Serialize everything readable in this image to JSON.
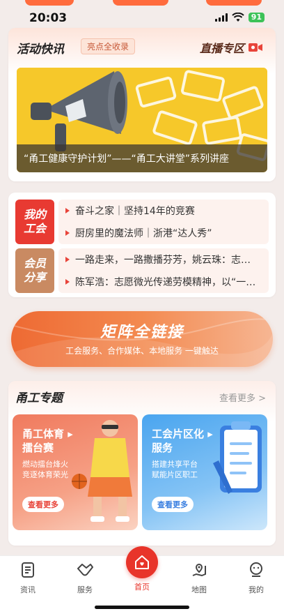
{
  "status_bar": {
    "time": "20:03",
    "battery": "91"
  },
  "activity": {
    "title": "活动快讯",
    "badge": "亮点全收录",
    "live_label": "直播专区",
    "banner_caption": "“甬工健康守护计划”——“甬工大讲堂”系列讲座"
  },
  "union_news": {
    "groups": [
      {
        "tag_line1": "我的",
        "tag_line2": "工会",
        "tag_color": "#e83a32",
        "items": [
          "奋斗之家｜坚持14年的竞赛",
          "厨房里的魔法师｜浙港“达人秀”"
        ]
      },
      {
        "tag_line1": "会员",
        "tag_line2": "分享",
        "tag_color": "#c98a62",
        "items": [
          "一路走来，一路撒播芬芳，姚云珠：志…",
          "陈军浩：志愿微光传递劳模精神，以“一…"
        ]
      }
    ]
  },
  "matrix": {
    "title": "矩阵全链接",
    "subtitle": "工会服务、合作媒体、本地服务 一键触达"
  },
  "topics": {
    "title": "甬工专题",
    "more": "查看更多 >",
    "tiles": [
      {
        "title_line1": "甬工体育",
        "title_line2": "擂台赛",
        "desc_line1": "燃动擂台烽火",
        "desc_line2": "竞逐体育荣光",
        "button": "查看更多",
        "color": "#f28a70"
      },
      {
        "title_line1": "工会片区化",
        "title_line2": "服务",
        "desc_line1": "搭建共享平台",
        "desc_line2": "赋能片区职工",
        "button": "查看更多",
        "color": "#5aaef0"
      }
    ]
  },
  "tab_bar": {
    "items": [
      {
        "label": "资讯",
        "icon": "news-icon"
      },
      {
        "label": "服务",
        "icon": "handshake-icon"
      },
      {
        "label": "首页",
        "icon": "home-icon"
      },
      {
        "label": "地图",
        "icon": "map-icon"
      },
      {
        "label": "我的",
        "icon": "profile-icon"
      }
    ],
    "accent": "#e8342a"
  }
}
